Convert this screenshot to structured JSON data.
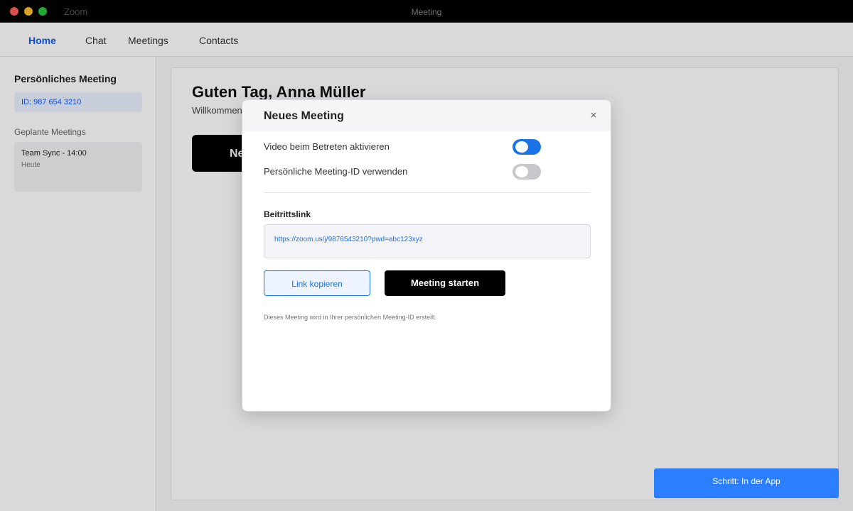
{
  "window": {
    "app_name": "Zoom",
    "title": "Meeting"
  },
  "nav": {
    "items": [
      {
        "label": "Home",
        "active": true
      },
      {
        "label": "Chat",
        "active": false
      },
      {
        "label": "Meetings",
        "active": false
      },
      {
        "label": "Contacts",
        "active": false
      }
    ]
  },
  "sidebar": {
    "title": "Persönliches Meeting",
    "meeting_id": "ID: 987 654 3210",
    "scheduled_label": "Geplante Meetings",
    "scheduled": [
      {
        "title": "Team Sync - 14:00",
        "subtitle": "Heute"
      }
    ]
  },
  "main": {
    "greeting": "Guten Tag, Anna Müller",
    "welcome": "Willkommen",
    "new_meeting_button_partial": "Ne"
  },
  "modal": {
    "title": "Neues Meeting",
    "close_glyph": "×",
    "options": [
      {
        "label": "Video beim Betreten aktivieren",
        "enabled": true
      },
      {
        "label": "Persönliche Meeting-ID verwenden",
        "enabled": false
      }
    ],
    "join_link_label": "Beitrittslink",
    "join_link": "https://zoom.us/j/9876543210?pwd=abc123xyz",
    "copy_button": "Link kopieren",
    "start_button": "Meeting starten",
    "info_text": "Dieses Meeting wird in Ihrer persönlichen Meeting-ID erstellt."
  },
  "step_badge": "Schritt: In der App",
  "colors": {
    "accent": "#1a73e8",
    "nav_active": "#0b5cff",
    "toggle_off": "#c8c8cc",
    "primary_button": "#000000",
    "step_badge": "#2b7fff"
  }
}
